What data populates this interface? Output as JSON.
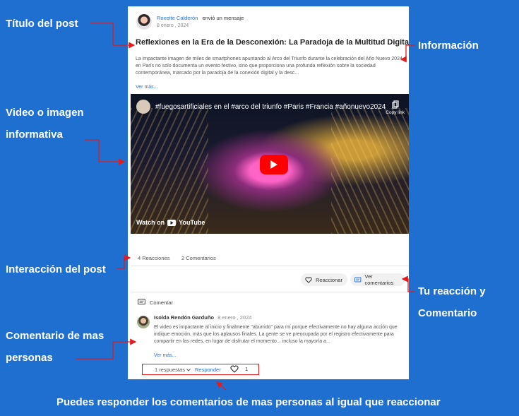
{
  "annotations": {
    "post_title": "Título del post",
    "information": "Información",
    "media_line1": "Video o imagen",
    "media_line2": "informativa",
    "interaction": "Interacción del post",
    "your_reaction_line1": "Tu reacción y",
    "your_reaction_line2": "Comentario",
    "others_comment_line1": "Comentario de mas",
    "others_comment_line2": "personas",
    "footer": "Puedes responder los comentarios de mas personas al igual que reaccionar"
  },
  "post": {
    "author": "Roxette Calderón",
    "action": "envió un mensaje",
    "date": "8 enero , 2024",
    "title": "Reflexiones en la Era de la Desconexión: La Paradoja de la Multitud Digital",
    "body": "La impactante imagen de miles de smartphones apuntando al Arco del Triunfo durante la celebración del Año Nuevo 2024 en París no solo documenta un evento festivo, sino que proporciona una profunda reflexión sobre la sociedad contemporánea, marcado por la paradoja de la conexión digital y la desc...",
    "see_more": "Ver más..."
  },
  "video": {
    "title": "#fuegosartificiales en el #arco del triunfo #Paris #Francia #añonuevo2024",
    "copy_link": "Copy link",
    "watch_on": "Watch on",
    "youtube": "YouTube"
  },
  "stats": {
    "reactions": "4 Reacciones",
    "comments": "2 Comentarios"
  },
  "actions": {
    "react": "Reaccionar",
    "view_comments": "Ver comentarios"
  },
  "comments": {
    "header": "Comentar",
    "items": [
      {
        "author": "Isolda Rendón Garduño",
        "date": "8 enero , 2024",
        "text": "El video es impactante al inicio y finalmente \"aburrido\" para mí porque efectivamente no hay alguna acción que indique emoción, más que los aplausos finales. La gente se ve preocupada por el registro efectivamente para compartir en las redes, en lugar de disfrutar el momento... incluso la mayoría a...",
        "see_more": "Ver más...",
        "replies": "1 respuestas",
        "reply": "Responder",
        "likes": "1"
      }
    ]
  },
  "colors": {
    "background": "#1f6fd0",
    "accent": "#2b6fd6",
    "highlight": "#e31b1b"
  }
}
